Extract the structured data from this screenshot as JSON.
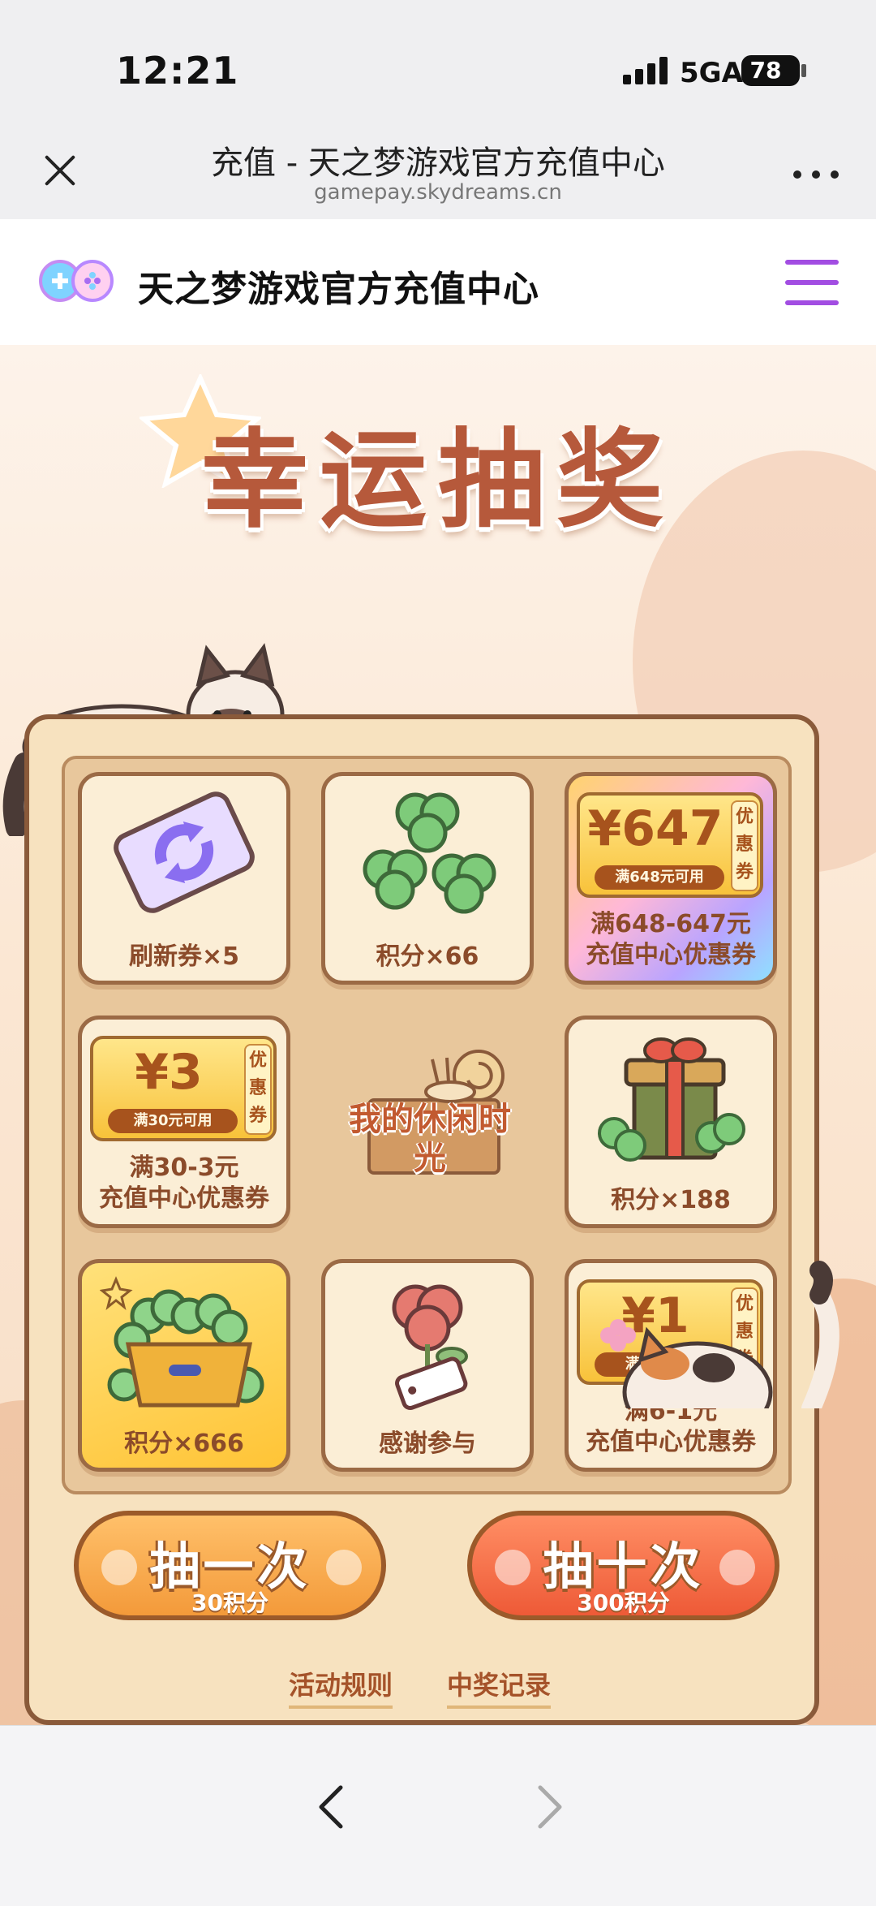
{
  "status_bar": {
    "time": "12:21",
    "network": "5GA",
    "battery": "78"
  },
  "browser": {
    "title": "充值 - 天之梦游戏官方充值中心",
    "url": "gamepay.skydreams.cn",
    "close_icon": "close-icon",
    "more_icon": "more-icon"
  },
  "site": {
    "name": "天之梦游戏官方充值中心",
    "logo_icon": "gamepad-logo-icon",
    "menu_icon": "hamburger-menu-icon",
    "menu_color": "#a24de2"
  },
  "lottery": {
    "title": "幸运抽奖",
    "center_logo_text": "我的休闲时光",
    "prizes": [
      {
        "label": "刷新券×5",
        "icon": "refresh-ticket-icon"
      },
      {
        "label": "积分×66",
        "icon": "clover-icon"
      },
      {
        "label_line1": "满648-647元",
        "label_line2": "充值中心优惠券",
        "amount": "¥647",
        "condition": "满648元可用",
        "tag": "优惠券"
      },
      {
        "label_line1": "满30-3元",
        "label_line2": "充值中心优惠券",
        "amount": "¥3",
        "condition": "满30元可用",
        "tag": "优惠券"
      },
      {
        "label": "积分×188",
        "icon": "gift-box-icon"
      },
      {
        "label": "积分×666",
        "icon": "clover-pot-icon"
      },
      {
        "label": "感谢参与",
        "icon": "flower-tag-icon"
      },
      {
        "label_line1": "满6-1元",
        "label_line2": "充值中心优惠券",
        "amount": "¥1",
        "condition": "满6元可用",
        "tag": "优惠券"
      }
    ],
    "draw_once": {
      "label": "抽一次",
      "cost": "30积分"
    },
    "draw_ten": {
      "label": "抽十次",
      "cost": "300积分"
    },
    "rules_link": "活动规则",
    "record_link": "中奖记录"
  },
  "nav": {
    "back_icon": "chevron-left-icon",
    "forward_icon": "chevron-right-icon"
  },
  "colors": {
    "title": "#b6593b",
    "board_border": "#8a5a3a",
    "once_button": "#f39a3a",
    "ten_button": "#ee5a37",
    "link": "#a5532a"
  }
}
